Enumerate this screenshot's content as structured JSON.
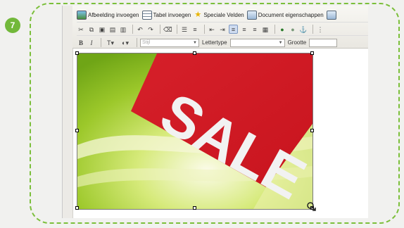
{
  "step": {
    "number": "7"
  },
  "toolbar": {
    "row1": {
      "insert_image": "Afbeelding invoegen",
      "insert_table": "Tabel invoegen",
      "special_fields": "Speciale Velden",
      "document_properties": "Document eigenschappen"
    },
    "row3": {
      "style_label": "Stijl",
      "font_label": "Lettertype",
      "size_label": "Grootte"
    }
  },
  "image": {
    "text": "SALE"
  },
  "colors": {
    "accent_green": "#72b83a",
    "sale_red": "#d8202a"
  }
}
